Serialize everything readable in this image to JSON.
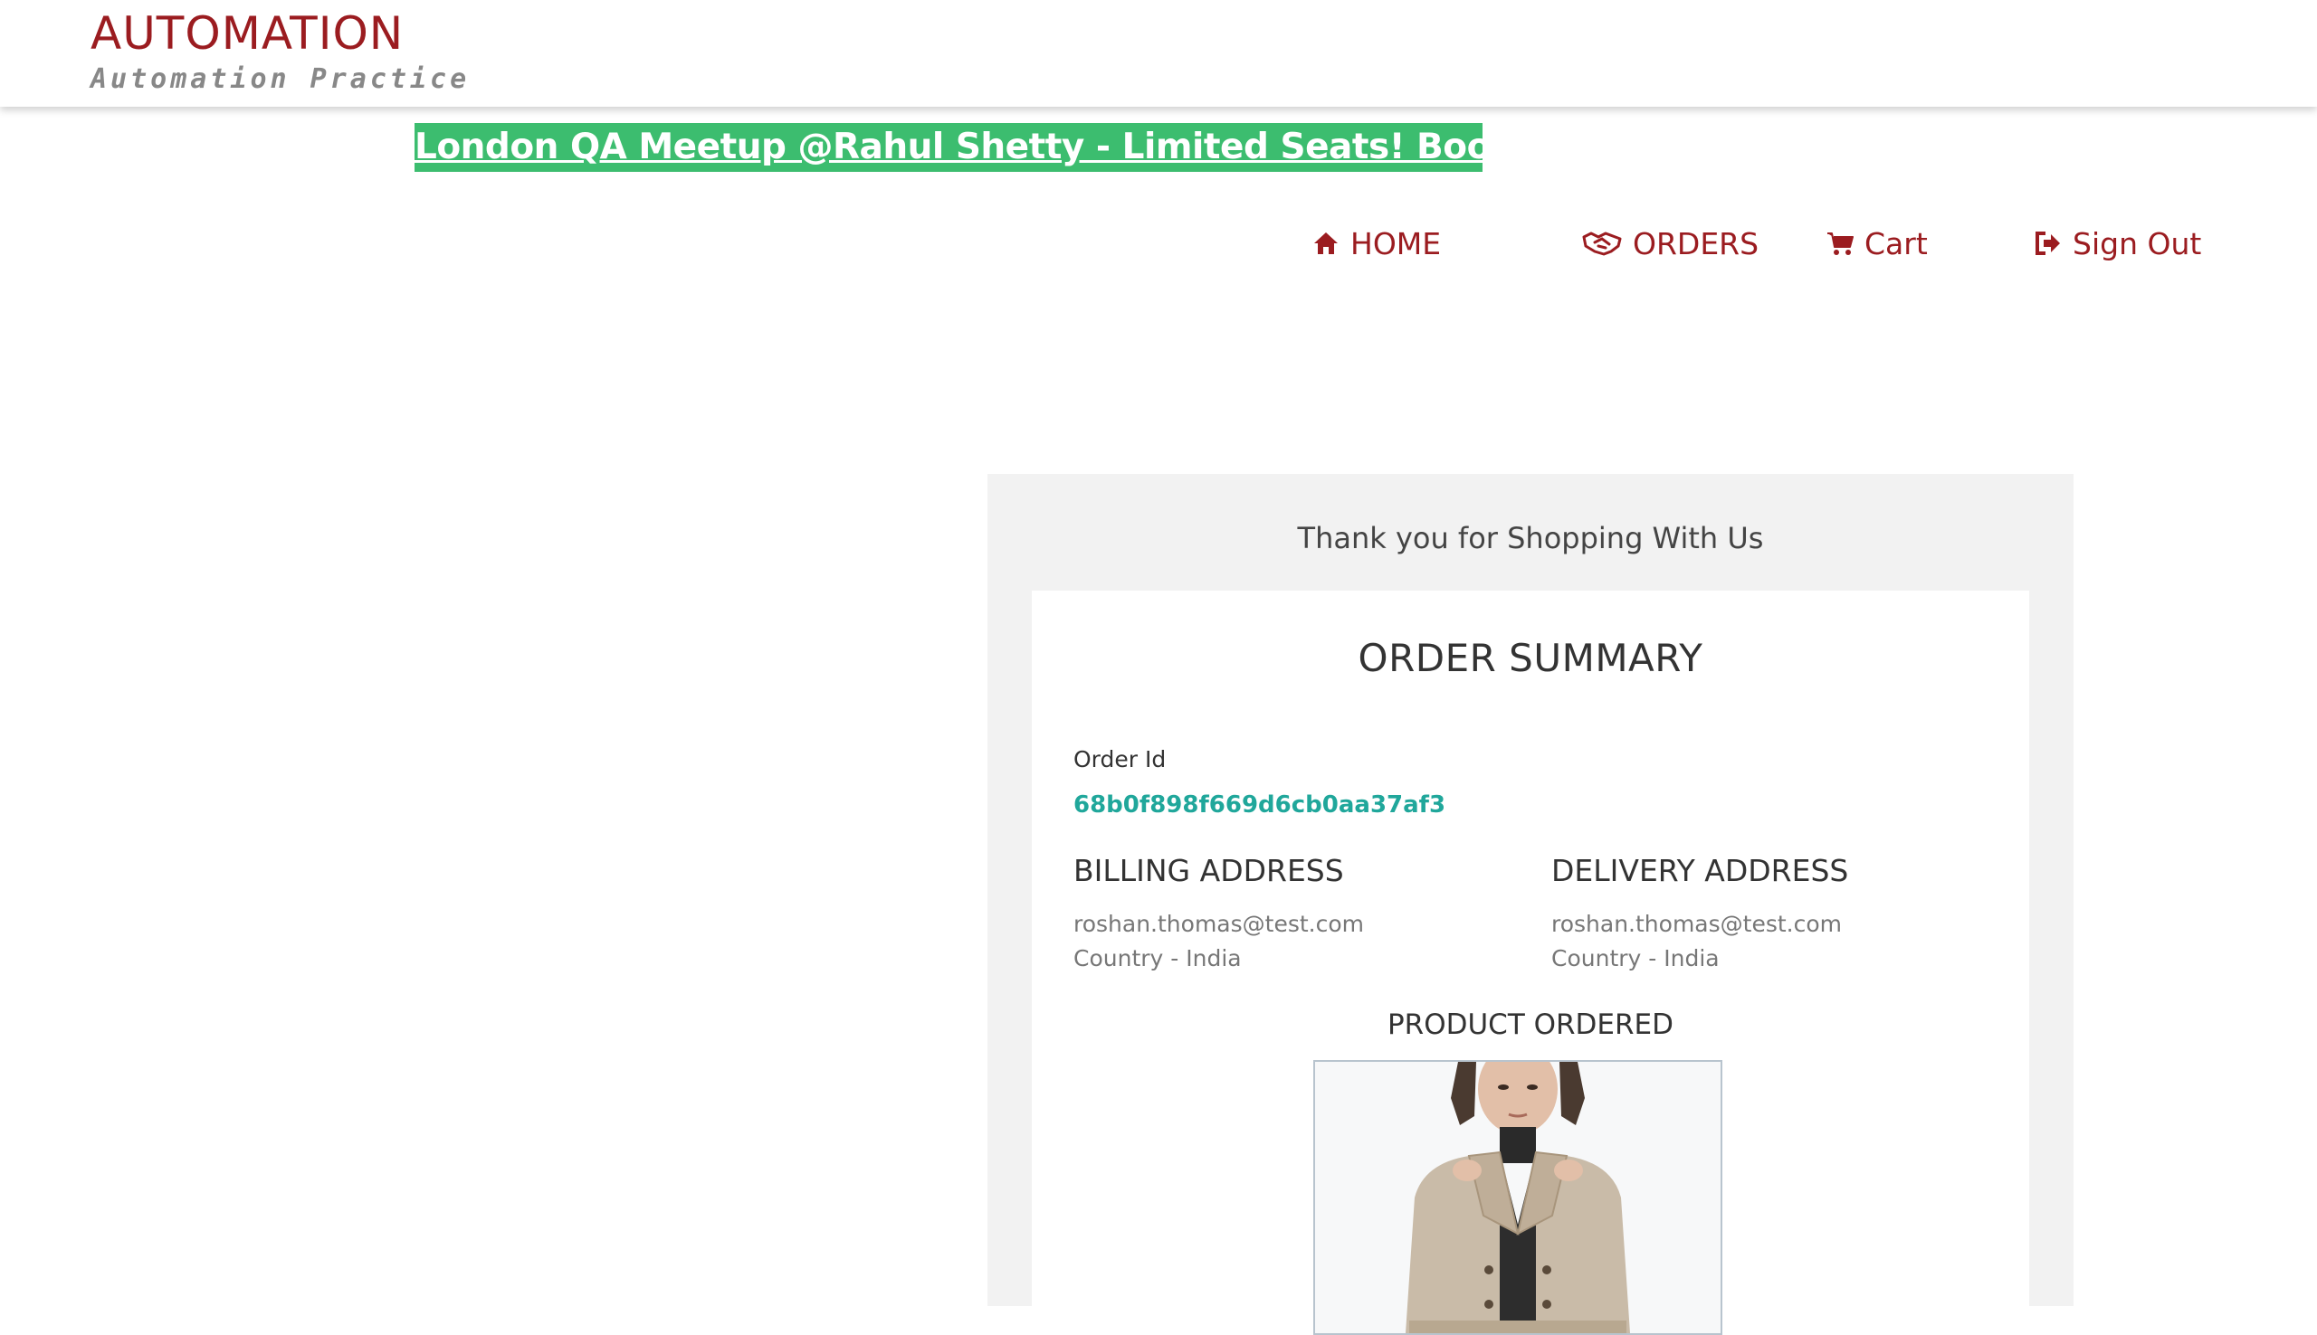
{
  "header": {
    "brand_title": "AUTOMATION",
    "brand_subtitle": "Automation Practice"
  },
  "banner": {
    "text": "London QA Meetup @Rahul Shetty - Limited Seats! Book Now!"
  },
  "nav": {
    "home": {
      "label": "HOME",
      "icon": "home-icon"
    },
    "orders": {
      "label": "ORDERS",
      "icon": "handshake-icon"
    },
    "cart": {
      "label": "Cart",
      "icon": "cart-icon"
    },
    "signout": {
      "label": "Sign Out",
      "icon": "sign-out-icon"
    }
  },
  "order": {
    "thank_you": "Thank you for Shopping With Us",
    "summary_title": "ORDER SUMMARY",
    "order_id_label": "Order Id",
    "order_id": "68b0f898f669d6cb0aa37af3",
    "billing": {
      "title": "BILLING ADDRESS",
      "email": "roshan.thomas@test.com",
      "country": "Country - India"
    },
    "delivery": {
      "title": "DELIVERY ADDRESS",
      "email": "roshan.thomas@test.com",
      "country": "Country - India"
    },
    "product_title": "PRODUCT ORDERED"
  },
  "colors": {
    "brand": "#9b1c20",
    "banner": "#3cbd6f",
    "order_id": "#20a79b"
  }
}
